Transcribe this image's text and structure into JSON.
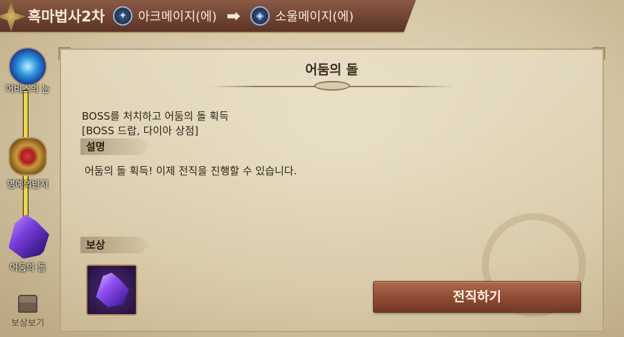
{
  "header": {
    "title": "흑마법사2차",
    "from_class": {
      "name": "아크메이지(에)",
      "icon": "wrench-staff-icon"
    },
    "arrow": "➡",
    "to_class": {
      "name": "소울메이지(에)",
      "icon": "soul-diamond-icon"
    }
  },
  "sidebar": {
    "progress_fraction": 1.0,
    "items": [
      {
        "label": "어비스의 눈",
        "icon": "abyss-eye-icon"
      },
      {
        "label": "명예의반지",
        "icon": "honor-ring-icon"
      },
      {
        "label": "어둠의 돌",
        "icon": "dark-stone-icon"
      }
    ],
    "reward_view": {
      "label": "보상보기",
      "icon": "treasure-chest-icon"
    }
  },
  "panel": {
    "title": "어둠의 돌",
    "objective_line1": "BOSS를 처치하고 어둠의 돌 획득",
    "objective_line2": "[BOSS 드랍, 다이아 상점]",
    "description_heading": "설명",
    "description_text": "어둠의 돌 획득! 이제 전직을 진행할 수 있습니다.",
    "reward_heading": "보상",
    "reward_item_icon": "purple-crystal-icon",
    "advance_button_label": "전직하기"
  },
  "colors": {
    "banner": "#6e4232",
    "button": "#8d4a33",
    "progress": "#e9d64a",
    "parchment": "#ddd0b0"
  }
}
